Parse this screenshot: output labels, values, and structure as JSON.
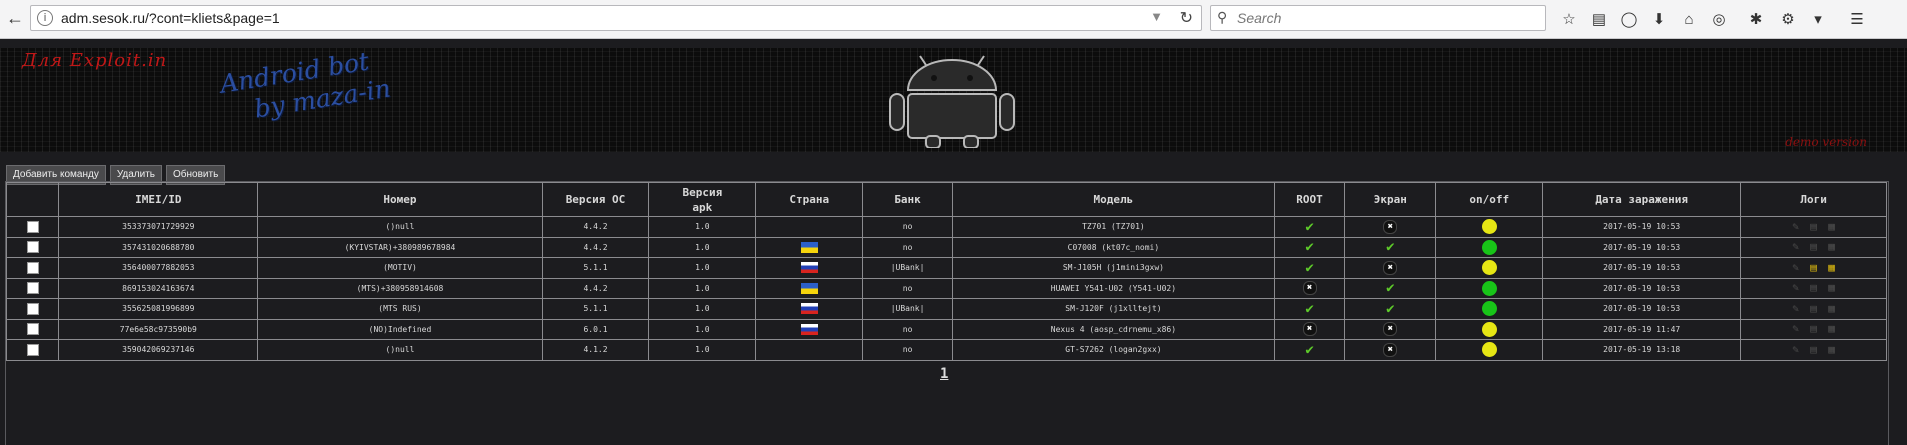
{
  "browser": {
    "url": "adm.sesok.ru/?cont=kliets&page=1",
    "search_placeholder": "Search"
  },
  "banner": {
    "top_left": "Для Exploit.in",
    "mid_line1": "Android bot",
    "mid_line2": "by maza-in",
    "bottom_right": "demo version"
  },
  "actions": {
    "add_command": "Добавить команду",
    "delete": "Удалить",
    "refresh": "Обновить"
  },
  "table": {
    "headers": {
      "imei": "IMEI/ID",
      "number": "Номер",
      "os_version": "Версия ОС",
      "apk_version": "Версия apk",
      "country": "Страна",
      "bank": "Банк",
      "model": "Модель",
      "root": "ROOT",
      "screen": "Экран",
      "onoff": "on/off",
      "date": "Дата заражения",
      "logs": "Логи"
    },
    "rows": [
      {
        "imei": "353373071729929",
        "number": "()null",
        "os": "4.4.2",
        "apk": "1.0",
        "country": "",
        "bank": "no",
        "model": "TZ701 (TZ701)",
        "root": "ok",
        "screen": "no",
        "status": "yellow",
        "date": "2017-05-19 10:53",
        "logs": "none"
      },
      {
        "imei": "357431020688780",
        "number": "(KYIVSTAR)+380989678984",
        "os": "4.4.2",
        "apk": "1.0",
        "country": "ua",
        "bank": "no",
        "model": "C07008 (kt07c_nomi)",
        "root": "ok",
        "screen": "ok",
        "status": "green",
        "date": "2017-05-19 10:53",
        "logs": "none"
      },
      {
        "imei": "356400077882053",
        "number": "(MOTIV)",
        "os": "5.1.1",
        "apk": "1.0",
        "country": "ru",
        "bank": "|UBank|",
        "model": "SM-J105H (j1mini3gxw)",
        "root": "ok",
        "screen": "no",
        "status": "yellow",
        "date": "2017-05-19 10:53",
        "logs": "bank"
      },
      {
        "imei": "869153024163674",
        "number": "(MTS)+380958914608",
        "os": "4.4.2",
        "apk": "1.0",
        "country": "ua",
        "bank": "no",
        "model": "HUAWEI Y541-U02 (Y541-U02)",
        "root": "no",
        "screen": "ok",
        "status": "green",
        "date": "2017-05-19 10:53",
        "logs": "none"
      },
      {
        "imei": "355625081996899",
        "number": "(MTS RUS)",
        "os": "5.1.1",
        "apk": "1.0",
        "country": "ru",
        "bank": "|UBank|",
        "model": "SM-J120F (j1xlltejt)",
        "root": "ok",
        "screen": "ok",
        "status": "green",
        "date": "2017-05-19 10:53",
        "logs": "none"
      },
      {
        "imei": "77e6e58c973590b9",
        "number": "(NO)Indefined",
        "os": "6.0.1",
        "apk": "1.0",
        "country": "ru",
        "bank": "no",
        "model": "Nexus 4 (aosp_cdrnemu_x86)",
        "root": "no",
        "screen": "no",
        "status": "yellow",
        "date": "2017-05-19 11:47",
        "logs": "none"
      },
      {
        "imei": "359042069237146",
        "number": "()null",
        "os": "4.1.2",
        "apk": "1.0",
        "country": "",
        "bank": "no",
        "model": "GT-S7262 (logan2gxx)",
        "root": "ok",
        "screen": "no",
        "status": "yellow",
        "date": "2017-05-19 13:18",
        "logs": "none"
      }
    ]
  },
  "pagination": {
    "current": "1"
  },
  "colors": {
    "bg": "#1c1c1f",
    "ok": "#5ecb2a",
    "online": "#18c418",
    "idle": "#e6e614",
    "banner_red": "#c01818",
    "banner_blue": "#2b4ea0"
  }
}
